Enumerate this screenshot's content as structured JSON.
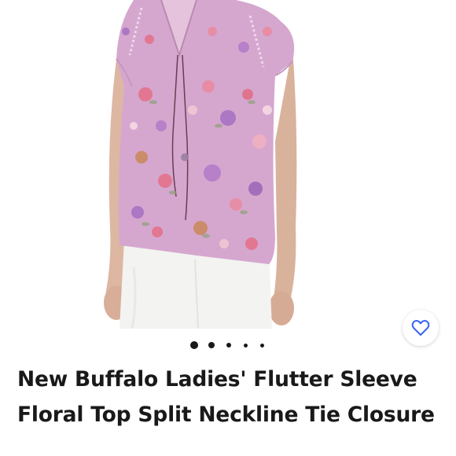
{
  "listing": {
    "title": "New Buffalo Ladies' Flutter Sleeve Floral Top Split Neckline Tie Closure"
  },
  "image_carousel": {
    "total_images": 5,
    "active_index": 0
  },
  "favorite_button": {
    "icon": "heart-outline-icon",
    "state": "not-saved"
  },
  "colors": {
    "accent": "#3665f3",
    "text": "#191919",
    "dot": "#191919"
  }
}
